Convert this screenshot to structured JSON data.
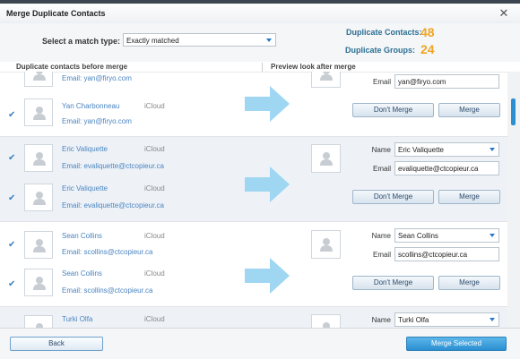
{
  "window": {
    "title": "Merge Duplicate Contacts"
  },
  "header": {
    "match_type_label": "Select a match type:",
    "match_type_value": "Exactly matched",
    "dup_contacts_label": "Duplicate Contacts:",
    "dup_contacts_value": "48",
    "dup_groups_label": "Duplicate Groups:",
    "dup_groups_value": "24"
  },
  "columns": {
    "before": "Duplicate contacts before merge",
    "after": "Preview look after merge"
  },
  "groups": [
    {
      "contacts": [
        {
          "name": "",
          "source": "",
          "email": "Email: yan@firyo.com"
        },
        {
          "name": "Yan  Charbonneau",
          "source": "iCloud",
          "email": "Email: yan@firyo.com"
        }
      ],
      "preview": {
        "email_label": "Email",
        "email": "yan@firyo.com"
      },
      "dont_merge": "Don't Merge",
      "merge": "Merge"
    },
    {
      "contacts": [
        {
          "name": "Eric Valiquette",
          "source": "iCloud",
          "email": "Email: evaliquette@ctcopieur.ca"
        },
        {
          "name": "Eric  Valiquette",
          "source": "iCloud",
          "email": "Email: evaliquette@ctcopieur.ca"
        }
      ],
      "preview": {
        "name_label": "Name",
        "name": "Eric Valiquette",
        "email_label": "Email",
        "email": "evaliquette@ctcopieur.ca"
      },
      "dont_merge": "Don't Merge",
      "merge": "Merge"
    },
    {
      "contacts": [
        {
          "name": "Sean Collins",
          "source": "iCloud",
          "email": "Email: scollins@ctcopieur.ca"
        },
        {
          "name": "Sean  Collins",
          "source": "iCloud",
          "email": "Email: scollins@ctcopieur.ca"
        }
      ],
      "preview": {
        "name_label": "Name",
        "name": "Sean Collins",
        "email_label": "Email",
        "email": "scollins@ctcopieur.ca"
      },
      "dont_merge": "Don't Merge",
      "merge": "Merge"
    },
    {
      "contacts": [
        {
          "name": "Turki Olfa",
          "source": "iCloud",
          "email": ""
        }
      ],
      "preview": {
        "name_label": "Name",
        "name": "Turki Olfa"
      }
    }
  ],
  "footer": {
    "back": "Back",
    "merge_selected": "Merge Selected"
  },
  "colors": {
    "accent": "#2b8fd1",
    "count": "#f0a523",
    "stat_label": "#2d6f93",
    "link": "#4a84c0"
  }
}
